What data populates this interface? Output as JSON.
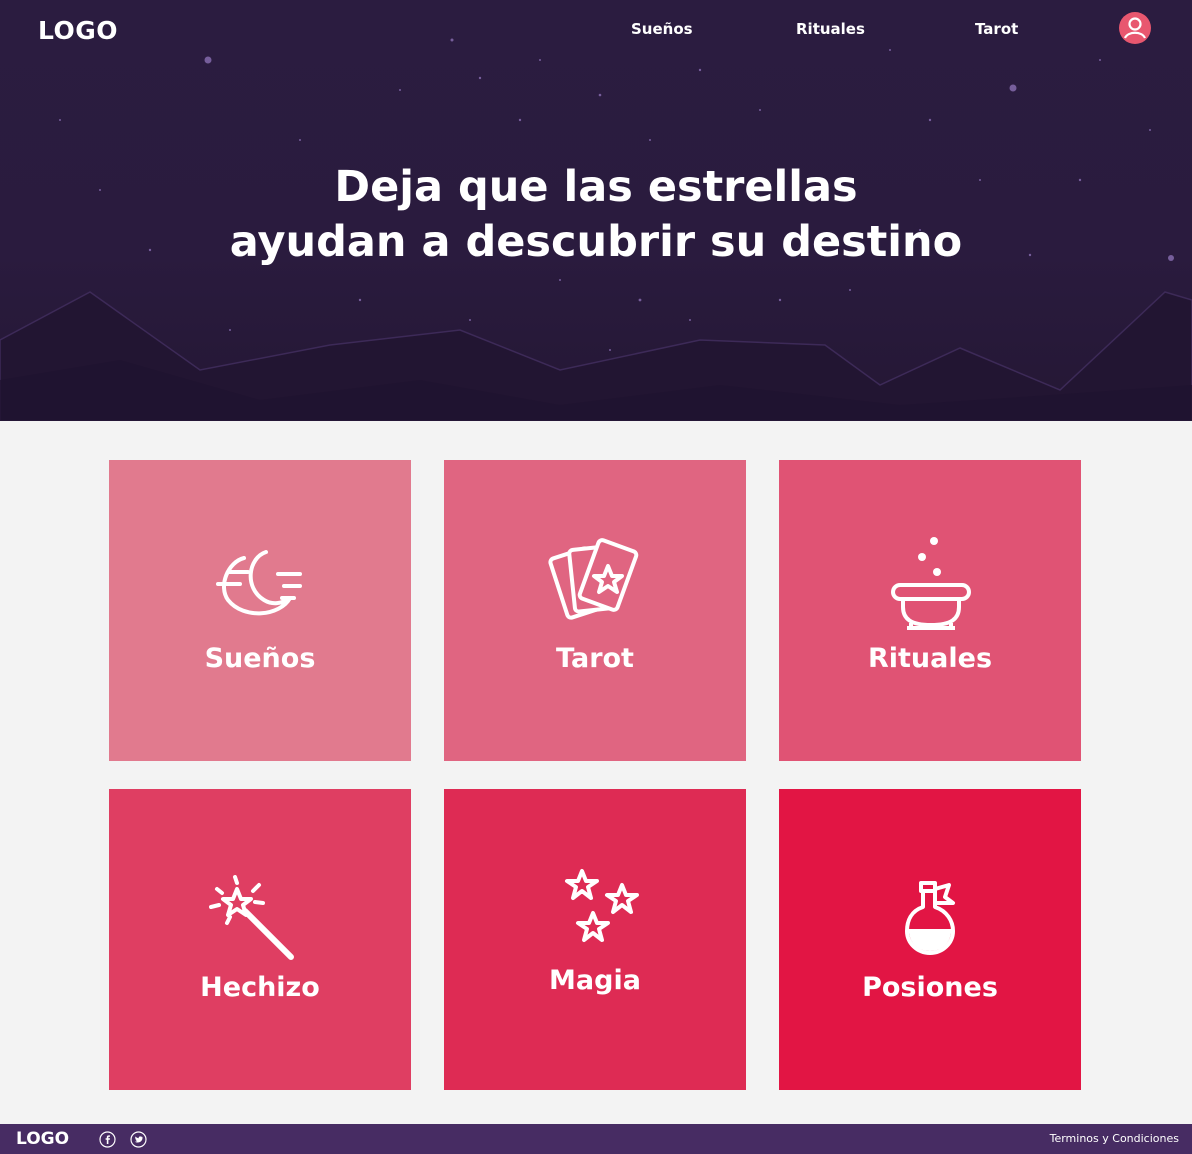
{
  "header": {
    "logo": "LOGO",
    "nav": [
      {
        "label": "Sueños"
      },
      {
        "label": "Rituales"
      },
      {
        "label": "Tarot"
      }
    ],
    "avatar_icon": "user-icon"
  },
  "hero": {
    "line1": "Deja que las estrellas",
    "line2": "ayudan a descubrir su destino"
  },
  "cards": [
    {
      "label": "Sueños",
      "icon": "moon-icon",
      "color": "#e17a8e"
    },
    {
      "label": "Tarot",
      "icon": "tarot-cards-icon",
      "color": "#e06581"
    },
    {
      "label": "Rituales",
      "icon": "cauldron-icon",
      "color": "#e05374"
    },
    {
      "label": "Hechizo",
      "icon": "magic-wand-icon",
      "color": "#df3e62"
    },
    {
      "label": "Magia",
      "icon": "stars-icon",
      "color": "#de2b54"
    },
    {
      "label": "Posiones",
      "icon": "potion-icon",
      "color": "#e21544"
    }
  ],
  "footer": {
    "logo": "LOGO",
    "social": [
      "facebook-icon",
      "twitter-icon"
    ],
    "terms": "Terminos y Condiciones"
  },
  "colors": {
    "hero_bg": "#2a1b3e",
    "footer_bg": "#472c63",
    "page_bg": "#f3f3f3",
    "avatar": "#e8576f"
  }
}
